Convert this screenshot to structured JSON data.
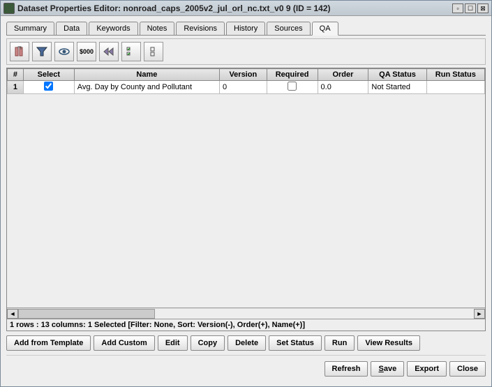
{
  "window": {
    "title": "Dataset Properties Editor: nonroad_caps_2005v2_jul_orl_nc.txt_v0 9 (ID = 142)"
  },
  "tabs": {
    "summary": "Summary",
    "data": "Data",
    "keywords": "Keywords",
    "notes": "Notes",
    "revisions": "Revisions",
    "history": "History",
    "sources": "Sources",
    "qa": "QA"
  },
  "toolbar": {
    "money_label": "$000"
  },
  "table": {
    "headers": {
      "rownum": "#",
      "select": "Select",
      "name": "Name",
      "version": "Version",
      "required": "Required",
      "order": "Order",
      "qa_status": "QA Status",
      "run_status": "Run Status"
    },
    "rows": [
      {
        "rownum": "1",
        "select": true,
        "name": "Avg. Day by County and Pollutant",
        "version": "0",
        "required": false,
        "order": "0.0",
        "qa_status": "Not Started",
        "run_status": ""
      }
    ]
  },
  "status": "1 rows : 13 columns: 1 Selected [Filter: None, Sort: Version(-), Order(+), Name(+)]",
  "buttons": {
    "add_from_template": "Add from Template",
    "add_custom": "Add Custom",
    "edit": "Edit",
    "copy": "Copy",
    "delete": "Delete",
    "set_status": "Set Status",
    "run": "Run",
    "view_results": "View Results",
    "refresh": "Refresh",
    "save": "Save",
    "export": "Export",
    "close": "Close"
  }
}
